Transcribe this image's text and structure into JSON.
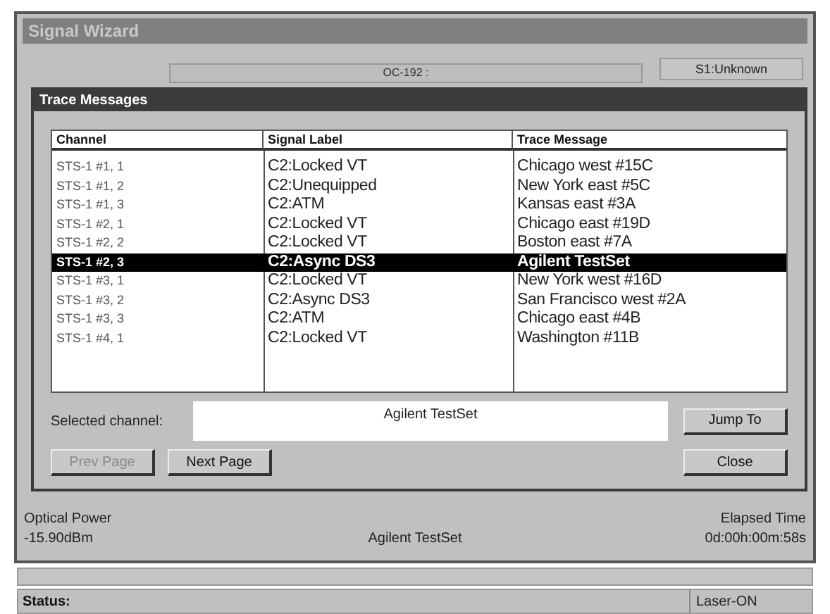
{
  "window": {
    "title": "Signal Wizard"
  },
  "background": {
    "signal_field": "OC-192 :",
    "s1_field": "S1:Unknown"
  },
  "dialog": {
    "title": "Trace Messages",
    "columns": [
      "Channel",
      "Signal Label",
      "Trace Message"
    ],
    "rows": [
      {
        "channel": "STS-1 #1, 1",
        "signal_label": "C2:Locked VT",
        "trace_message": "Chicago west #15C",
        "selected": false
      },
      {
        "channel": "STS-1 #1, 2",
        "signal_label": "C2:Unequipped",
        "trace_message": "New York east #5C",
        "selected": false
      },
      {
        "channel": "STS-1 #1, 3",
        "signal_label": "C2:ATM",
        "trace_message": "Kansas east #3A",
        "selected": false
      },
      {
        "channel": "STS-1 #2, 1",
        "signal_label": "C2:Locked VT",
        "trace_message": "Chicago east #19D",
        "selected": false
      },
      {
        "channel": "STS-1 #2, 2",
        "signal_label": "C2:Locked VT",
        "trace_message": "Boston east #7A",
        "selected": false
      },
      {
        "channel": "STS-1 #2, 3",
        "signal_label": "C2:Async DS3",
        "trace_message": "Agilent TestSet",
        "selected": true
      },
      {
        "channel": "STS-1 #3, 1",
        "signal_label": "C2:Locked VT",
        "trace_message": "New York west #16D",
        "selected": false
      },
      {
        "channel": "STS-1 #3, 2",
        "signal_label": "C2:Async DS3",
        "trace_message": "San Francisco west #2A",
        "selected": false
      },
      {
        "channel": "STS-1 #3, 3",
        "signal_label": "C2:ATM",
        "trace_message": "Chicago east #4B",
        "selected": false
      },
      {
        "channel": "STS-1 #4, 1",
        "signal_label": "C2:Locked VT",
        "trace_message": "Washington #11B",
        "selected": false
      }
    ],
    "selected_channel": {
      "label": "Selected channel:",
      "value": "Agilent TestSet"
    },
    "buttons": [
      {
        "label": "Jump To",
        "disabled": false
      },
      {
        "label": "Prev Page",
        "disabled": true
      },
      {
        "label": "Next Page",
        "disabled": false
      },
      {
        "label": "Close",
        "disabled": false
      }
    ]
  },
  "footer": {
    "optical_power_label": "Optical Power",
    "optical_power": "-15.90dBm",
    "trace": "Agilent TestSet",
    "elapsed_label": "Elapsed Time",
    "elapsed": "0d:00h:00m:58s"
  },
  "status_bar": {
    "label": "Status:",
    "laser": "Laser-ON"
  }
}
